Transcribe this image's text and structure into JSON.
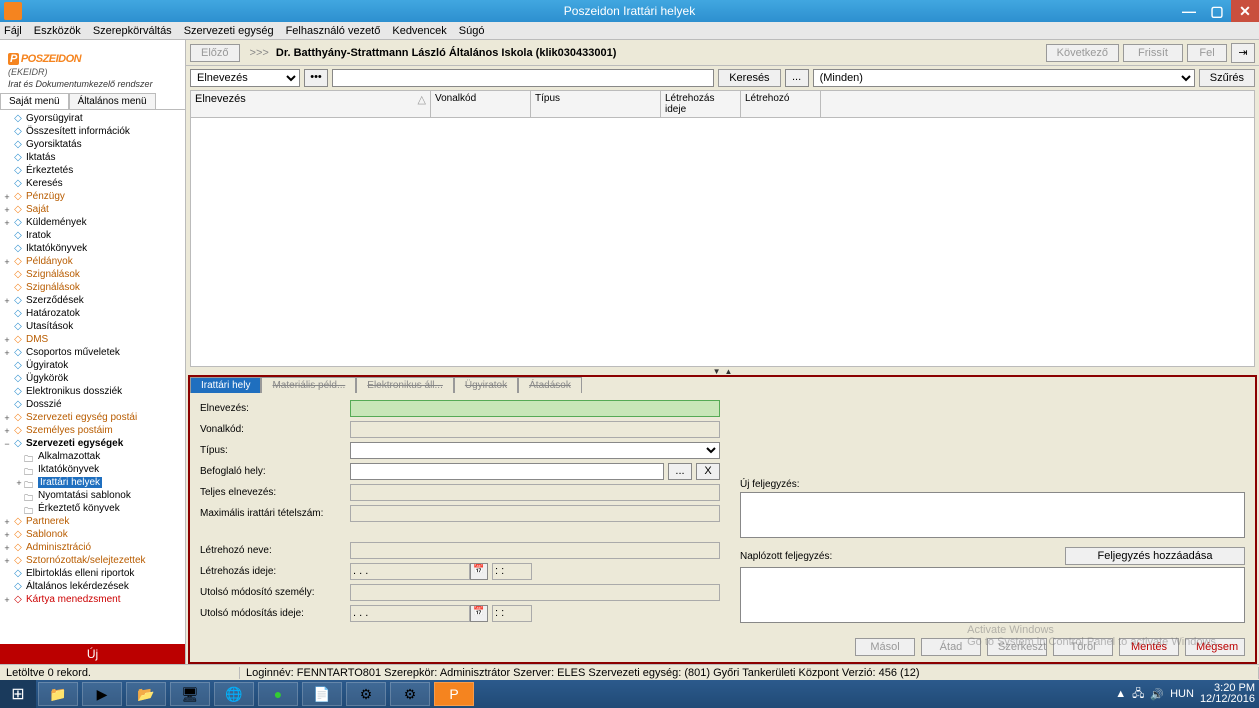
{
  "window": {
    "title": "Poszeidon Irattári helyek"
  },
  "menubar": [
    "Fájl",
    "Eszközök",
    "Szerepkörváltás",
    "Szervezeti egység",
    "Felhasználó vezető",
    "Kedvencek",
    "Súgó"
  ],
  "logo": {
    "name": "POSZEIDON",
    "sub": "(EKEIDR)",
    "desc": "Irat és Dokumentumkezelő rendszer"
  },
  "sidebar_tabs": {
    "own": "Saját menü",
    "general": "Általános menü"
  },
  "tree": [
    {
      "lbl": "Gyorsügyirat",
      "cls": ""
    },
    {
      "lbl": "Összesített információk",
      "cls": ""
    },
    {
      "lbl": "Gyorsiktatás",
      "cls": ""
    },
    {
      "lbl": "Iktatás",
      "cls": ""
    },
    {
      "lbl": "Érkeztetés",
      "cls": ""
    },
    {
      "lbl": "Keresés",
      "cls": ""
    },
    {
      "lbl": "Pénzügy",
      "cls": "orange",
      "exp": "+"
    },
    {
      "lbl": "Saját",
      "cls": "orange",
      "exp": "+"
    },
    {
      "lbl": "Küldemények",
      "cls": "",
      "exp": "+"
    },
    {
      "lbl": "Iratok",
      "cls": ""
    },
    {
      "lbl": "Iktatókönyvek",
      "cls": ""
    },
    {
      "lbl": "Példányok",
      "cls": "orange",
      "exp": "+"
    },
    {
      "lbl": "Szignálások",
      "cls": "orange"
    },
    {
      "lbl": "Szignálások",
      "cls": "orange"
    },
    {
      "lbl": "Szerződések",
      "cls": "",
      "exp": "+"
    },
    {
      "lbl": "Határozatok",
      "cls": ""
    },
    {
      "lbl": "Utasítások",
      "cls": ""
    },
    {
      "lbl": "DMS",
      "cls": "orange",
      "exp": "+"
    },
    {
      "lbl": "Csoportos műveletek",
      "cls": "",
      "exp": "+"
    },
    {
      "lbl": "Ügyiratok",
      "cls": ""
    },
    {
      "lbl": "Ügykörök",
      "cls": ""
    },
    {
      "lbl": "Elektronikus dossziék",
      "cls": ""
    },
    {
      "lbl": "Dosszié",
      "cls": ""
    },
    {
      "lbl": "Szervezeti egység postái",
      "cls": "orange",
      "exp": "+"
    },
    {
      "lbl": "Személyes postáim",
      "cls": "orange",
      "exp": "+"
    },
    {
      "lbl": "Szervezeti egységek",
      "cls": "bold",
      "exp": "−"
    },
    {
      "lbl": "Alkalmazottak",
      "cls": "indent1",
      "folder": true
    },
    {
      "lbl": "Iktatókönyvek",
      "cls": "indent1",
      "folder": true
    },
    {
      "lbl": "Irattári helyek",
      "cls": "indent1 selected",
      "folder": true,
      "exp": "+"
    },
    {
      "lbl": "Nyomtatási sablonok",
      "cls": "indent1",
      "folder": true
    },
    {
      "lbl": "Érkeztető könyvek",
      "cls": "indent1",
      "folder": true
    },
    {
      "lbl": "Partnerek",
      "cls": "orange",
      "exp": "+"
    },
    {
      "lbl": "Sablonok",
      "cls": "orange",
      "exp": "+"
    },
    {
      "lbl": "Adminisztráció",
      "cls": "orange",
      "exp": "+"
    },
    {
      "lbl": "Sztornózottak/selejtezettek",
      "cls": "orange",
      "exp": "+"
    },
    {
      "lbl": "Elbirtoklás elleni riportok",
      "cls": ""
    },
    {
      "lbl": "Általános lekérdezések",
      "cls": ""
    },
    {
      "lbl": "Kártya menedzsment",
      "cls": "red",
      "exp": "+"
    }
  ],
  "sidebar_footer": "Új",
  "toolbar": {
    "prev": "Előző",
    "breadcrumb_arrow": ">>>",
    "breadcrumb": "Dr. Batthyány-Strattmann László Általános Iskola (klik030433001)",
    "next": "Következő",
    "refresh": "Frissít",
    "up": "Fel"
  },
  "search": {
    "combo": "Elnevezés",
    "search_btn": "Keresés",
    "dots": "...",
    "filter_combo": "(Minden)",
    "filter_btn": "Szűrés"
  },
  "grid_cols": [
    "Elnevezés",
    "Vonalkód",
    "Típus",
    "Létrehozás ideje",
    "Létrehozó"
  ],
  "detail_tabs": [
    "Irattári hely",
    "Materiális péld...",
    "Elektronikus áll...",
    "Ügyiratok",
    "Átadások"
  ],
  "form": {
    "elnevezes": "Elnevezés:",
    "vonalkod": "Vonalkód:",
    "tipus": "Típus:",
    "befoglalo": "Befoglaló hely:",
    "teljes": "Teljes elnevezés:",
    "max": "Maximális irattári tételszám:",
    "letrehozo_neve": "Létrehozó neve:",
    "letrehozas_ideje": "Létrehozás ideje:",
    "modosito": "Utolsó módosító személy:",
    "modositas_ideje": "Utolsó módosítás ideje:",
    "date_placeholder": ". . .",
    "time_placeholder": ": :",
    "x_btn": "X",
    "dots_btn": "..."
  },
  "notes": {
    "uj": "Új feljegyzés:",
    "naplozott": "Naplózott feljegyzés:",
    "add_btn": "Feljegyzés hozzáadása"
  },
  "detail_buttons": {
    "masol": "Másol",
    "atad": "Átad",
    "szerkeszt": "Szerkeszt",
    "torol": "Töröl",
    "mentes": "Mentés",
    "megsem": "Mégsem"
  },
  "statusbar": {
    "records": "Letöltve 0 rekord.",
    "info": "Loginnév: FENNTARTO801   Szerepkör: Adminisztrátor   Szerver: ELES   Szervezeti egység: (801) Győri Tankerületi Központ   Verzió: 456 (12)"
  },
  "watermark": {
    "title": "Activate Windows",
    "sub": "Go to System in Control Panel to activate Windows."
  },
  "taskbar": {
    "lang": "HUN",
    "time": "3:20 PM",
    "date": "12/12/2016"
  }
}
